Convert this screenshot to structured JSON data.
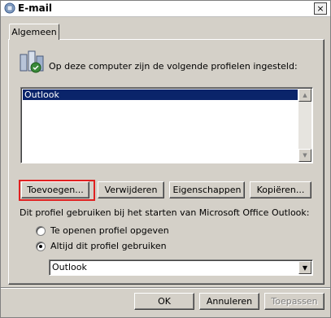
{
  "window": {
    "title": "E-mail",
    "close_label": "×"
  },
  "tabs": [
    {
      "label": "Algemeen",
      "selected": true
    }
  ],
  "general": {
    "intro_text": "Op deze computer zijn de volgende profielen ingesteld:",
    "profiles": [
      {
        "name": "Outlook",
        "selected": true
      }
    ],
    "buttons": {
      "add": "Toevoegen...",
      "remove": "Verwijderen",
      "properties": "Eigenschappen",
      "copy": "Kopiëren..."
    },
    "startup_label": "Dit profiel gebruiken bij het starten van Microsoft Office Outlook:",
    "options": [
      {
        "label": "Te openen profiel opgeven",
        "checked": false
      },
      {
        "label": "Altijd dit profiel gebruiken",
        "checked": true
      }
    ],
    "default_profile": "Outlook"
  },
  "footer": {
    "ok": "OK",
    "cancel": "Annuleren",
    "apply": "Toepassen",
    "apply_enabled": false
  },
  "colors": {
    "face": "#d4d0c8",
    "selection": "#0a246a",
    "highlight_border": "#e02020"
  },
  "icons": {
    "app": "mail-settings-icon",
    "profiles": "profiles-icon",
    "close": "close-icon",
    "scroll_up": "scroll-up-arrow-icon",
    "scroll_down": "scroll-down-arrow-icon",
    "dropdown": "dropdown-arrow-icon"
  }
}
